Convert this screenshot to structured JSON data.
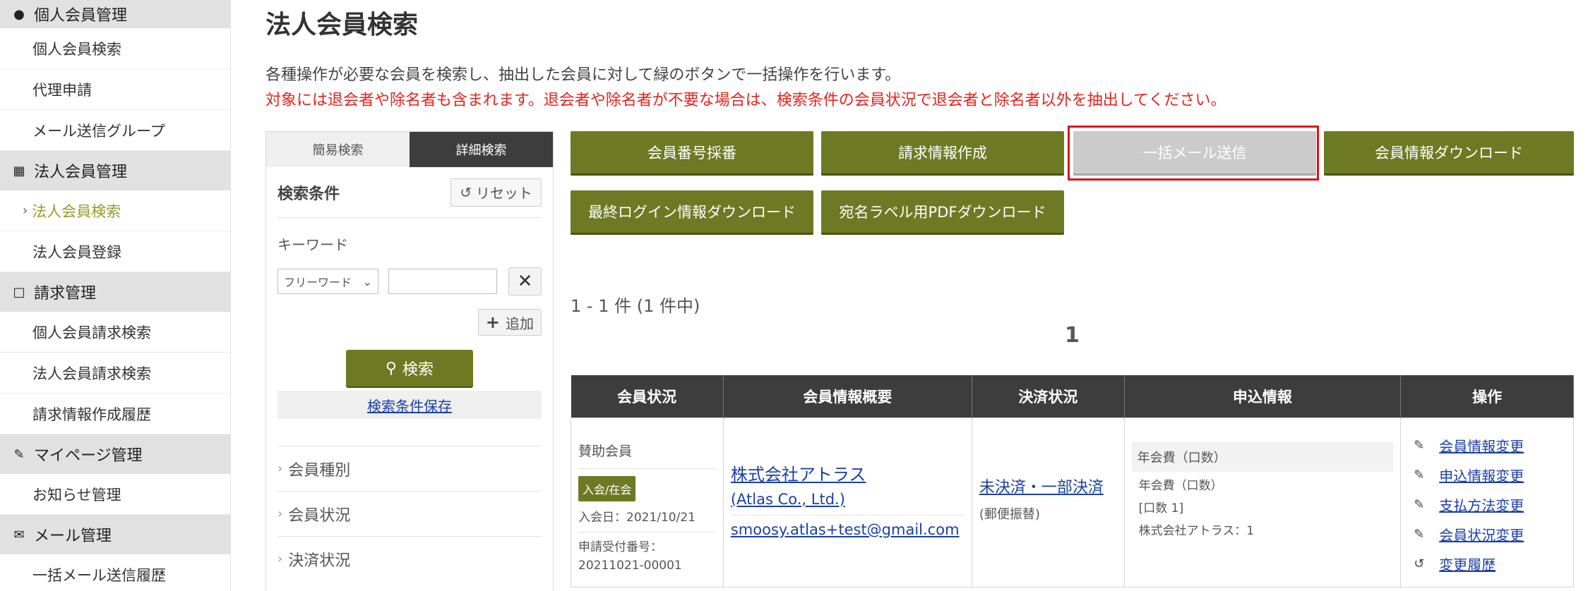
{
  "sidebar": {
    "sections": [
      {
        "label": "個人会員管理",
        "icon": "person-icon",
        "items": [
          "個人会員検索",
          "代理申請",
          "メール送信グループ"
        ]
      },
      {
        "label": "法人会員管理",
        "icon": "building-icon",
        "items": [
          "法人会員検索",
          "法人会員登録"
        ]
      },
      {
        "label": "請求管理",
        "icon": "document-icon",
        "items": [
          "個人会員請求検索",
          "法人会員請求検索",
          "請求情報作成履歴"
        ]
      },
      {
        "label": "マイページ管理",
        "icon": "pen-icon",
        "items": [
          "お知らせ管理"
        ]
      },
      {
        "label": "メール管理",
        "icon": "mail-icon",
        "items": [
          "一括メール送信履歴"
        ]
      }
    ],
    "active_item": "法人会員検索"
  },
  "page": {
    "title": "法人会員検索",
    "description": "各種操作が必要な会員を検索し、抽出した会員に対して緑のボタンで一括操作を行います。",
    "warning": "対象には退会者や除名者も含まれます。退会者や除名者が不要な場合は、検索条件の会員状況で退会者と除名者以外を抽出してください。"
  },
  "search": {
    "tab_simple": "簡易検索",
    "tab_detail": "詳細検索",
    "conditions_title": "検索条件",
    "reset_label": "リセット",
    "keyword_label": "キーワード",
    "keyword_select": "フリーワード",
    "keyword_value": "",
    "add_label": "追加",
    "search_label": "検索",
    "save_label": "検索条件保存",
    "filters": [
      "会員種別",
      "会員状況",
      "決済状況"
    ]
  },
  "actions": {
    "number_assign": "会員番号採番",
    "billing_create": "請求情報作成",
    "bulk_mail": "一括メール送信",
    "member_download": "会員情報ダウンロード",
    "last_login_download": "最終ログイン情報ダウンロード",
    "label_pdf_download": "宛名ラベル用PDFダウンロード"
  },
  "results": {
    "count_text": "1 - 1 件 (1 件中)",
    "page_number": "1"
  },
  "table": {
    "headers": [
      "会員状況",
      "会員情報概要",
      "決済状況",
      "申込情報",
      "操作"
    ],
    "row": {
      "member_type": "賛助会員",
      "status_badge": "入会/在会",
      "join_date": "入会日：2021/10/21",
      "application_no_label": "申請受付番号：",
      "application_no": "20211021-00001",
      "company_name": "株式会社アトラス",
      "company_en": "(Atlas Co., Ltd.)",
      "email": "smoosy.atlas+test@gmail.com",
      "payment_status": "未決済・一部決済",
      "payment_method": "(郵便振替)",
      "fee_header": "年会費（口数）",
      "fee_name": "年会費（口数）",
      "fee_units": "[口数 1]",
      "fee_detail": "株式会社アトラス：1",
      "operations": [
        {
          "label": "会員情報変更",
          "icon": "edit-icon"
        },
        {
          "label": "申込情報変更",
          "icon": "edit-icon"
        },
        {
          "label": "支払方法変更",
          "icon": "edit-icon"
        },
        {
          "label": "会員状況変更",
          "icon": "edit-icon"
        },
        {
          "label": "変更履歴",
          "icon": "history-icon"
        }
      ]
    }
  },
  "colors": {
    "accent_green": "#6d7a23",
    "disabled_gray": "#cbcbcb",
    "warning_red": "#e8231d",
    "link_blue": "#1a3fa7",
    "highlight_red": "#e0101e"
  }
}
